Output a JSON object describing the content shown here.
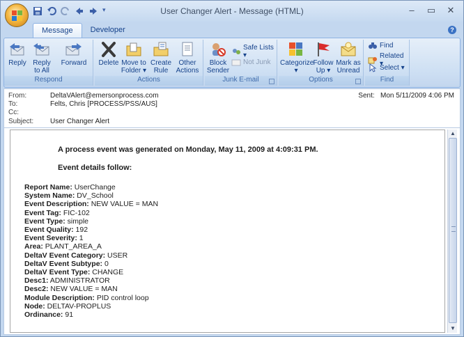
{
  "window": {
    "title": "User Changer Alert - Message (HTML)",
    "controls": {
      "minimize": "–",
      "maximize": "▭",
      "close": "✕"
    }
  },
  "tabs": [
    {
      "label": "Message",
      "active": true
    },
    {
      "label": "Developer",
      "active": false
    }
  ],
  "ribbon": {
    "respond": {
      "label": "Respond",
      "reply": "Reply",
      "reply_all_1": "Reply",
      "reply_all_2": "to All",
      "forward": "Forward"
    },
    "actions": {
      "label": "Actions",
      "delete": "Delete",
      "move_1": "Move to",
      "move_2": "Folder ▾",
      "create_1": "Create",
      "create_2": "Rule",
      "other_1": "Other",
      "other_2": "Actions ▾"
    },
    "junk": {
      "label": "Junk E-mail",
      "block_1": "Block",
      "block_2": "Sender",
      "safe_lists": "Safe Lists ▾",
      "not_junk": "Not Junk"
    },
    "options": {
      "label": "Options",
      "categorize_1": "Categorize",
      "categorize_2": "▾",
      "follow_1": "Follow",
      "follow_2": "Up ▾",
      "mark_1": "Mark as",
      "mark_2": "Unread"
    },
    "find": {
      "label": "Find",
      "find": "Find",
      "related": "Related ▾",
      "select": "Select ▾"
    }
  },
  "header": {
    "from_label": "From:",
    "from": "DeltaVAlert@emersonprocess.com",
    "to_label": "To:",
    "to": "Felts, Chris [PROCESS/PSS/AUS]",
    "cc_label": "Cc:",
    "cc": "",
    "subject_label": "Subject:",
    "subject": "User Changer Alert",
    "sent_label": "Sent:",
    "sent": "Mon 5/11/2009 4:06 PM"
  },
  "message": {
    "line1": "A process event was generated on Monday, May 11, 2009 at 4:09:31 PM.",
    "line2": "Event details follow:",
    "details": [
      {
        "k": "Report Name:",
        "v": " UserChange"
      },
      {
        "k": "System Name:",
        "v": " DV_School"
      },
      {
        "k": "Event Description:",
        "v": " NEW VALUE = MAN"
      },
      {
        "k": "Event Tag:",
        "v": " FIC-102"
      },
      {
        "k": "Event Type:",
        "v": " simple"
      },
      {
        "k": "Event Quality:",
        "v": " 192"
      },
      {
        "k": "Event Severity:",
        "v": " 1"
      },
      {
        "k": "Area:",
        "v": " PLANT_AREA_A"
      },
      {
        "k": "DeltaV Event Category:",
        "v": " USER"
      },
      {
        "k": "DeltaV Event Subtype:",
        "v": " 0"
      },
      {
        "k": "DeltaV Event Type:",
        "v": " CHANGE"
      },
      {
        "k": "Desc1:",
        "v": " ADMINISTRATOR"
      },
      {
        "k": "Desc2:",
        "v": " NEW VALUE = MAN"
      },
      {
        "k": "Module Description:",
        "v": " PID control loop"
      },
      {
        "k": "Node:",
        "v": " DELTAV-PROPLUS"
      },
      {
        "k": "Ordinance:",
        "v": " 91"
      }
    ]
  }
}
